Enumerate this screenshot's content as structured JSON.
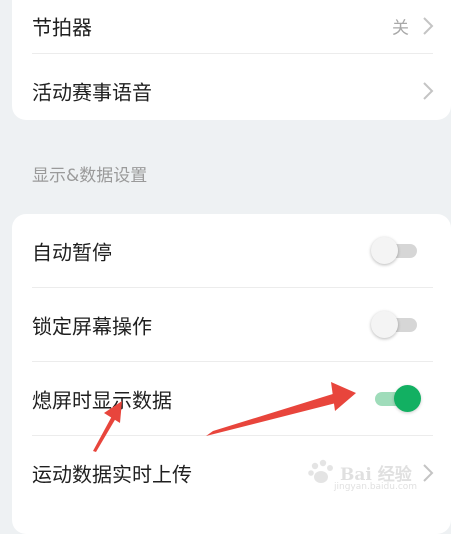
{
  "group_top": {
    "items": [
      {
        "label": "节拍器",
        "value": "关"
      },
      {
        "label": "活动赛事语音"
      }
    ]
  },
  "section": {
    "title": "显示&数据设置"
  },
  "group_display": {
    "items": [
      {
        "label": "自动暂停",
        "enabled": false
      },
      {
        "label": "锁定屏幕操作",
        "enabled": false
      },
      {
        "label": "熄屏时显示数据",
        "enabled": true
      },
      {
        "label": "运动数据实时上传"
      }
    ]
  },
  "colors": {
    "accent_green": "#12b062",
    "annotation_red": "#e8453c"
  },
  "watermark": {
    "text": "Bai 经验",
    "subtext": "jingyan.baidu.com"
  }
}
